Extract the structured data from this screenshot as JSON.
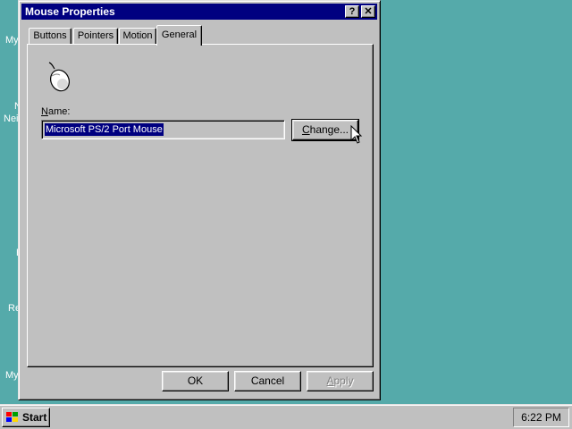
{
  "desktop": {
    "labels": [
      "My",
      "N",
      "Neig",
      "E",
      "Re",
      "My"
    ],
    "background": "#55AAAA"
  },
  "window": {
    "title": "Mouse Properties",
    "help_label": "?",
    "close_label": "✕",
    "tabs": [
      {
        "label": "Buttons",
        "active": false
      },
      {
        "label": "Pointers",
        "active": false
      },
      {
        "label": "Motion",
        "active": false
      },
      {
        "label": "General",
        "active": true
      }
    ],
    "general": {
      "icon": "mouse-icon",
      "name_label_underlined": "N",
      "name_label_rest": "ame:",
      "name_value": "Microsoft PS/2 Port Mouse",
      "change_label_pre": "C",
      "change_label_rest": "hange..."
    },
    "buttons": {
      "ok": "OK",
      "cancel": "Cancel",
      "apply_underlined": "A",
      "apply_rest": "pply"
    }
  },
  "taskbar": {
    "start_label": "Start",
    "clock": "6:22 PM"
  }
}
